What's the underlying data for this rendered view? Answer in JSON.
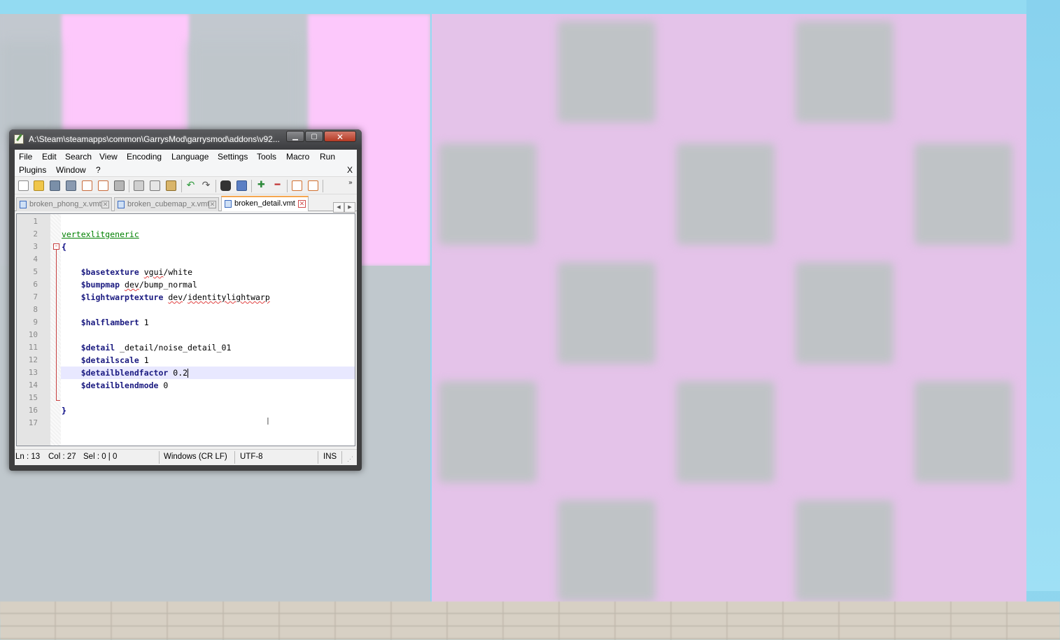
{
  "window": {
    "title": "A:\\Steam\\steamapps\\common\\GarrysMod\\garrysmod\\addons\\v92..."
  },
  "menu": {
    "row1": [
      "File",
      "Edit",
      "Search",
      "View",
      "Encoding",
      "Language",
      "Settings",
      "Tools",
      "Macro",
      "Run"
    ],
    "row2": [
      "Plugins",
      "Window",
      "?"
    ],
    "close_label": "X"
  },
  "toolbar": {
    "buttons": [
      "new-file-icon",
      "open-file-icon",
      "save-icon",
      "save-all-icon",
      "close-icon",
      "close-all-icon",
      "print-icon",
      "cut-icon",
      "copy-icon",
      "paste-icon",
      "undo-icon",
      "redo-icon",
      "find-icon",
      "replace-icon",
      "zoom-in-icon",
      "zoom-out-icon",
      "sync-vertical-icon",
      "sync-horizontal-icon"
    ],
    "more_label": "»"
  },
  "tabs": [
    {
      "label": "broken_phong_x.vmt",
      "active": false
    },
    {
      "label": "broken_cubemap_x.vmt",
      "active": false
    },
    {
      "label": "broken_detail.vmt",
      "active": true
    }
  ],
  "editor": {
    "lines": [
      {
        "n": "1",
        "text": ""
      },
      {
        "n": "2",
        "text": "vertexlitgeneric"
      },
      {
        "n": "3",
        "text": "{"
      },
      {
        "n": "4",
        "text": ""
      },
      {
        "n": "5",
        "text": "    $basetexture vgui/white"
      },
      {
        "n": "6",
        "text": "    $bumpmap dev/bump_normal"
      },
      {
        "n": "7",
        "text": "    $lightwarptexture dev/identitylightwarp"
      },
      {
        "n": "8",
        "text": ""
      },
      {
        "n": "9",
        "text": "    $halflambert 1"
      },
      {
        "n": "10",
        "text": ""
      },
      {
        "n": "11",
        "text": "    $detail _detail/noise_detail_01"
      },
      {
        "n": "12",
        "text": "    $detailscale 1"
      },
      {
        "n": "13",
        "text": "    $detailblendfactor 0.2"
      },
      {
        "n": "14",
        "text": "    $detailblendmode 0"
      },
      {
        "n": "15",
        "text": ""
      },
      {
        "n": "16",
        "text": "}"
      },
      {
        "n": "17",
        "text": ""
      }
    ],
    "current_line": 13
  },
  "status": {
    "ln": "Ln : 13",
    "col": "Col : 27",
    "sel": "Sel : 0 | 0",
    "eol": "Windows (CR LF)",
    "encoding": "UTF-8",
    "mode": "INS"
  },
  "colors": {
    "keyword": "#1a1a80",
    "section": "#008000",
    "current_line_bg": "#e8e8ff",
    "active_tab_accent": "#f5a650"
  }
}
